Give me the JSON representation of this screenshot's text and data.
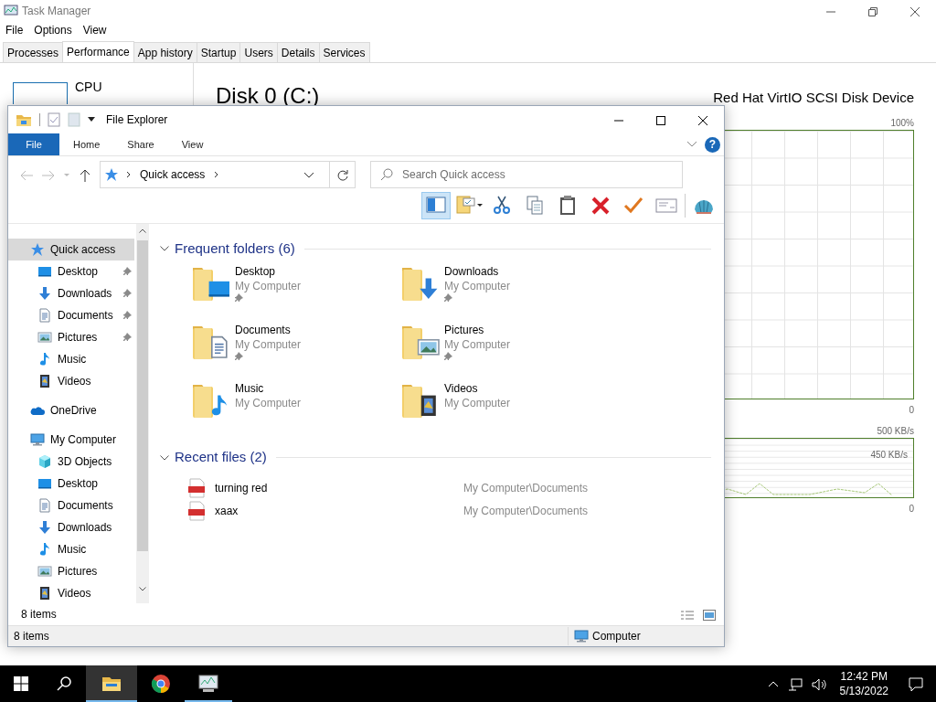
{
  "task_manager": {
    "title": "Task Manager",
    "menu": [
      "File",
      "Options",
      "View"
    ],
    "tabs": [
      {
        "label": "Processes",
        "selected": false
      },
      {
        "label": "Performance",
        "selected": true
      },
      {
        "label": "App history",
        "selected": false
      },
      {
        "label": "Startup",
        "selected": false
      },
      {
        "label": "Users",
        "selected": false
      },
      {
        "label": "Details",
        "selected": false
      },
      {
        "label": "Services",
        "selected": false
      }
    ],
    "sidebar": [
      {
        "label": "CPU"
      }
    ],
    "heading": "Disk 0 (C:)",
    "device": "Red Hat VirtIO SCSI Disk Device",
    "graph_labels": {
      "active_max": "100%",
      "active_min": "0",
      "transfer_max": "500 KB/s",
      "transfer_mark": "450 KB/s",
      "transfer_min": "0"
    }
  },
  "explorer": {
    "title": "File Explorer",
    "ribbon_tabs": [
      {
        "label": "File",
        "kind": "file"
      },
      {
        "label": "Home",
        "kind": "tab"
      },
      {
        "label": "Share",
        "kind": "tab"
      },
      {
        "label": "View",
        "kind": "tab"
      }
    ],
    "help": "?",
    "address": [
      "Quick access"
    ],
    "search": {
      "placeholder": "Search Quick access"
    },
    "toolbar": [
      {
        "kind": "pane",
        "selected": true
      },
      {
        "kind": "properties",
        "selected": false
      },
      {
        "kind": "cut",
        "selected": false
      },
      {
        "kind": "copy",
        "selected": false
      },
      {
        "kind": "paste",
        "selected": false
      },
      {
        "kind": "delete",
        "selected": false
      },
      {
        "kind": "check",
        "selected": false
      },
      {
        "kind": "card",
        "selected": false
      },
      {
        "kind": "shell",
        "selected": false
      }
    ],
    "nav": [
      {
        "label": "Quick access",
        "kind": "quickaccess",
        "selected": true,
        "children": [
          {
            "label": "Desktop",
            "kind": "desktop",
            "selected": false,
            "pinned": true
          },
          {
            "label": "Downloads",
            "kind": "downloads",
            "selected": false,
            "pinned": true
          },
          {
            "label": "Documents",
            "kind": "documents",
            "selected": false,
            "pinned": true
          },
          {
            "label": "Pictures",
            "kind": "pictures",
            "selected": false,
            "pinned": true
          },
          {
            "label": "Music",
            "kind": "music",
            "selected": false,
            "pinned": false
          },
          {
            "label": "Videos",
            "kind": "videos",
            "selected": false,
            "pinned": false
          }
        ]
      },
      {
        "label": "OneDrive",
        "kind": "onedrive",
        "selected": false
      },
      {
        "label": "My Computer",
        "kind": "computer",
        "selected": false,
        "children": [
          {
            "label": "3D Objects",
            "kind": "objects3d",
            "selected": false
          },
          {
            "label": "Desktop",
            "kind": "desktop",
            "selected": false
          },
          {
            "label": "Documents",
            "kind": "documents",
            "selected": false
          },
          {
            "label": "Downloads",
            "kind": "downloads",
            "selected": false
          },
          {
            "label": "Music",
            "kind": "music",
            "selected": false
          },
          {
            "label": "Pictures",
            "kind": "pictures",
            "selected": false
          },
          {
            "label": "Videos",
            "kind": "videos",
            "selected": false
          }
        ]
      }
    ],
    "frequent": {
      "title": "Frequent folders (6)",
      "expanded": true,
      "folders": [
        {
          "name": "Desktop",
          "location": "My Computer",
          "kind": "desktop",
          "pinned": true
        },
        {
          "name": "Downloads",
          "location": "My Computer",
          "kind": "downloads",
          "pinned": true
        },
        {
          "name": "Documents",
          "location": "My Computer",
          "kind": "documents",
          "pinned": true
        },
        {
          "name": "Pictures",
          "location": "My Computer",
          "kind": "pictures",
          "pinned": true
        },
        {
          "name": "Music",
          "location": "My Computer",
          "kind": "music",
          "pinned": false
        },
        {
          "name": "Videos",
          "location": "My Computer",
          "kind": "videos",
          "pinned": false
        }
      ]
    },
    "recent": {
      "title": "Recent files (2)",
      "expanded": true,
      "files": [
        {
          "name": "turning red",
          "location": "My Computer\\Documents"
        },
        {
          "name": "xaax",
          "location": "My Computer\\Documents"
        }
      ]
    },
    "nav_count": "8 items",
    "status": {
      "items": "8 items",
      "location": "Computer"
    }
  },
  "taskbar": {
    "apps": [
      {
        "kind": "explorer",
        "selected": true,
        "running": true
      },
      {
        "kind": "chrome",
        "selected": false,
        "running": false
      },
      {
        "kind": "taskmgr",
        "selected": false,
        "running": true
      }
    ],
    "time": "12:42 PM",
    "date": "5/13/2022"
  }
}
